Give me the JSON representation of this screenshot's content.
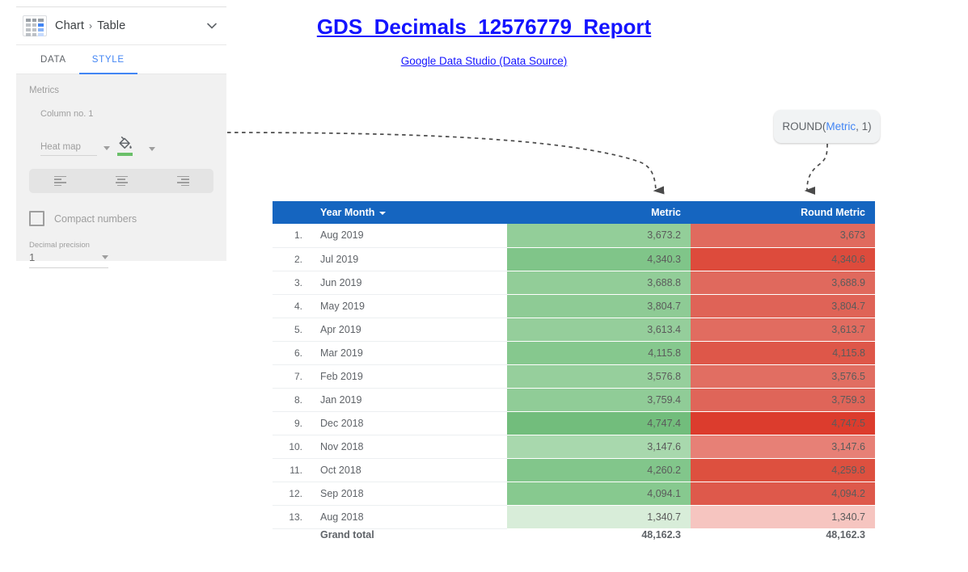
{
  "panel": {
    "icon": "table-chart-icon",
    "breadcrumb_chart": "Chart",
    "breadcrumb_sep": "›",
    "breadcrumb_table": "Table",
    "tabs": [
      {
        "label": "DATA",
        "active": false
      },
      {
        "label": "STYLE",
        "active": true
      }
    ],
    "section_label": "Metrics",
    "column_label": "Column no. 1",
    "style_select_value": "Heat map",
    "swatch_color": "#6abf69",
    "align_options": [
      "align-left",
      "align-center",
      "align-right"
    ],
    "compact_numbers_label": "Compact numbers",
    "compact_numbers_checked": false,
    "decimal_precision_label": "Decimal precision",
    "decimal_precision_value": "1"
  },
  "report": {
    "title": "GDS_Decimals_12576779_Report",
    "subtitle": "Google Data Studio (Data Source)",
    "link_color": "#1414ff"
  },
  "annotation": {
    "formula_prefix": "ROUND(",
    "formula_arg": "Metric",
    "formula_suffix": ", 1)"
  },
  "chart_data": {
    "type": "table",
    "title": "GDS_Decimals_12576779_Report",
    "columns": [
      "Year Month",
      "Metric",
      "Round Metric"
    ],
    "sorted_by": "Year Month",
    "index_suffix": ".",
    "header_bg": "#1565c0",
    "heatmap_colors": {
      "metric": "#7ec68a",
      "round_metric": "#e05a4e"
    },
    "rows": [
      {
        "index": "1.",
        "dim": "Aug 2019",
        "metric": "3,673.2",
        "round_metric": "3,673",
        "metric_val": 3673.2,
        "round_val": 3673.2,
        "g": "#93ce99",
        "r": "#e06a5e"
      },
      {
        "index": "2.",
        "dim": "Jul 2019",
        "metric": "4,340.3",
        "round_metric": "4,340.6",
        "metric_val": 4340.3,
        "round_val": 4340.6,
        "g": "#80c589",
        "r": "#dd4b3c"
      },
      {
        "index": "3.",
        "dim": "Jun 2019",
        "metric": "3,688.8",
        "round_metric": "3,688.9",
        "metric_val": 3688.8,
        "round_val": 3688.9,
        "g": "#92cd98",
        "r": "#e0695d"
      },
      {
        "index": "4.",
        "dim": "May 2019",
        "metric": "3,804.7",
        "round_metric": "3,804.7",
        "metric_val": 3804.7,
        "round_val": 3804.7,
        "g": "#8ecb95",
        "r": "#df6357"
      },
      {
        "index": "5.",
        "dim": "Apr 2019",
        "metric": "3,613.4",
        "round_metric": "3,613.7",
        "metric_val": 3613.4,
        "round_val": 3613.7,
        "g": "#95ce9b",
        "r": "#e16c60"
      },
      {
        "index": "6.",
        "dim": "Mar 2019",
        "metric": "4,115.8",
        "round_metric": "4,115.8",
        "metric_val": 4115.8,
        "round_val": 4115.8,
        "g": "#86c88e",
        "r": "#de5749"
      },
      {
        "index": "7.",
        "dim": "Feb 2019",
        "metric": "3,576.8",
        "round_metric": "3,576.5",
        "metric_val": 3576.8,
        "round_val": 3576.5,
        "g": "#96cf9c",
        "r": "#e16e62"
      },
      {
        "index": "8.",
        "dim": "Jan 2019",
        "metric": "3,759.4",
        "round_metric": "3,759.3",
        "metric_val": 3759.4,
        "round_val": 3759.3,
        "g": "#90cc97",
        "r": "#df6559"
      },
      {
        "index": "9.",
        "dim": "Dec 2018",
        "metric": "4,747.4",
        "round_metric": "4,747.5",
        "metric_val": 4747.4,
        "round_val": 4747.5,
        "g": "#72bd7c",
        "r": "#dc3c2d"
      },
      {
        "index": "10.",
        "dim": "Nov 2018",
        "metric": "3,147.6",
        "round_metric": "3,147.6",
        "metric_val": 3147.6,
        "round_val": 3147.6,
        "g": "#a8d8ad",
        "r": "#e78076"
      },
      {
        "index": "11.",
        "dim": "Oct 2018",
        "metric": "4,260.2",
        "round_metric": "4,259.8",
        "metric_val": 4260.2,
        "round_val": 4259.8,
        "g": "#82c68b",
        "r": "#dd503f"
      },
      {
        "index": "12.",
        "dim": "Sep 2018",
        "metric": "4,094.1",
        "round_metric": "4,094.2",
        "metric_val": 4094.1,
        "round_val": 4094.2,
        "g": "#87c98f",
        "r": "#de594b"
      },
      {
        "index": "13.",
        "dim": "Aug 2018",
        "metric": "1,340.7",
        "round_metric": "1,340.7",
        "metric_val": 1340.7,
        "round_val": 1340.7,
        "g": "#d8edd9",
        "r": "#f6c5c0"
      }
    ],
    "grand_total": {
      "label": "Grand total",
      "metric": "48,162.3",
      "round_metric": "48,162.3"
    }
  }
}
